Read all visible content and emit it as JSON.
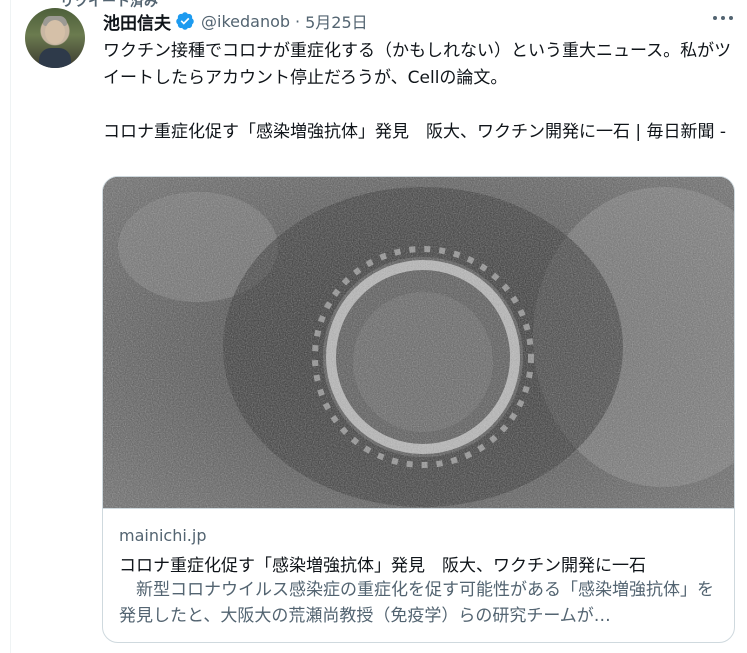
{
  "tweet": {
    "retweet_text": "リツイート済み",
    "author_name": "池田信夫",
    "author_handle": "@ikedanob",
    "separator": "·",
    "date": "5月25日",
    "body_line1": "ワクチン接種でコロナが重症化する（かもしれない）という重大ニュース。私がツイートしたらアカウント停止だろうが、Cellの論文。",
    "body_line2": "コロナ重症化促す「感染増強抗体」発見　阪大、ワクチン開発に一石 | 毎日新聞 -"
  },
  "card": {
    "domain": "mainichi.jp",
    "title": "コロナ重症化促す「感染増強抗体」発見　阪大、ワクチン開発に一石",
    "description": "　新型コロナウイルス感染症の重症化を促す可能性がある「感染増強抗体」を発見したと、大阪大の荒瀬尚教授（免疫学）らの研究チームが…"
  },
  "colors": {
    "text": "#0f1419",
    "secondary": "#536471",
    "border": "#cfd9de",
    "verified": "#1d9bf0"
  },
  "icons": [
    "verified-badge-icon",
    "more-options-icon"
  ]
}
